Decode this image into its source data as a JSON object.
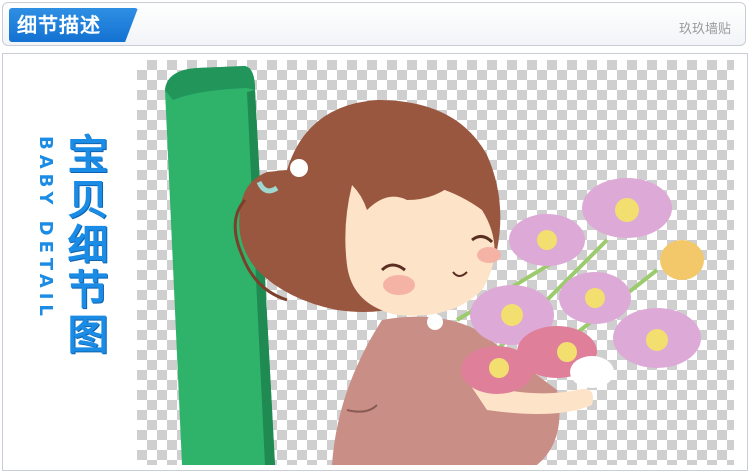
{
  "header": {
    "title": "细节描述",
    "brand": "玖玖墙贴"
  },
  "side_title": {
    "cn": [
      "宝",
      "贝",
      "细",
      "节",
      "图"
    ],
    "en": "BABY DETAIL"
  },
  "colors": {
    "accent_blue": "#1b8ce6",
    "green_bar": "#2fb36a",
    "hair": "#9a573f",
    "dress": "#c98f86",
    "flowers_pink": "#dda9d6",
    "flowers_yellow": "#f2df70"
  }
}
